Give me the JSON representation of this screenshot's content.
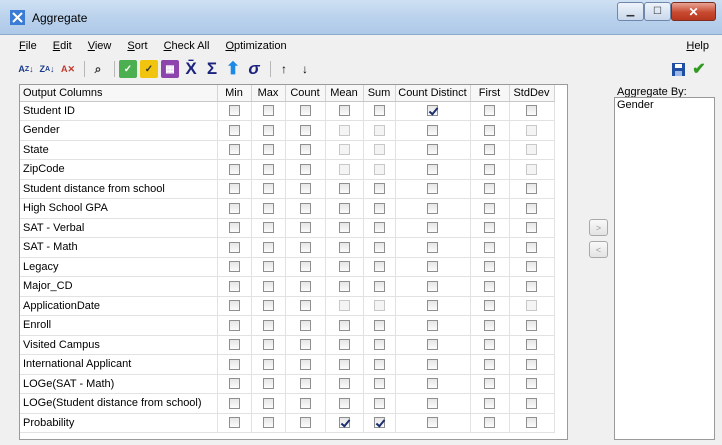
{
  "window": {
    "title": "Aggregate"
  },
  "menu": {
    "file": "File",
    "edit": "Edit",
    "view": "View",
    "sort": "Sort",
    "check_all": "Check All",
    "optimization": "Optimization",
    "help": "Help"
  },
  "columns": [
    "Output Columns",
    "Min",
    "Max",
    "Count",
    "Mean",
    "Sum",
    "Count Distinct",
    "First",
    "StdDev"
  ],
  "rows": [
    {
      "name": "Student ID",
      "states": [
        "n",
        "n",
        "n",
        "n",
        "n",
        "c",
        "n",
        "n"
      ]
    },
    {
      "name": "Gender",
      "states": [
        "n",
        "n",
        "n",
        "d",
        "d",
        "n",
        "n",
        "d"
      ]
    },
    {
      "name": "State",
      "states": [
        "n",
        "n",
        "n",
        "d",
        "d",
        "n",
        "n",
        "d"
      ]
    },
    {
      "name": "ZipCode",
      "states": [
        "n",
        "n",
        "n",
        "d",
        "d",
        "n",
        "n",
        "d"
      ]
    },
    {
      "name": "Student distance from school",
      "states": [
        "n",
        "n",
        "n",
        "n",
        "n",
        "n",
        "n",
        "n"
      ]
    },
    {
      "name": "High School GPA",
      "states": [
        "n",
        "n",
        "n",
        "n",
        "n",
        "n",
        "n",
        "n"
      ]
    },
    {
      "name": "SAT - Verbal",
      "states": [
        "n",
        "n",
        "n",
        "n",
        "n",
        "n",
        "n",
        "n"
      ]
    },
    {
      "name": "SAT - Math",
      "states": [
        "n",
        "n",
        "n",
        "n",
        "n",
        "n",
        "n",
        "n"
      ]
    },
    {
      "name": "Legacy",
      "states": [
        "n",
        "n",
        "n",
        "n",
        "n",
        "n",
        "n",
        "n"
      ]
    },
    {
      "name": "Major_CD",
      "states": [
        "n",
        "n",
        "n",
        "n",
        "n",
        "n",
        "n",
        "n"
      ]
    },
    {
      "name": "ApplicationDate",
      "states": [
        "n",
        "n",
        "n",
        "d",
        "d",
        "n",
        "n",
        "d"
      ]
    },
    {
      "name": "Enroll",
      "states": [
        "n",
        "n",
        "n",
        "n",
        "n",
        "n",
        "n",
        "n"
      ]
    },
    {
      "name": "Visited Campus",
      "states": [
        "n",
        "n",
        "n",
        "n",
        "n",
        "n",
        "n",
        "n"
      ]
    },
    {
      "name": "International Applicant",
      "states": [
        "n",
        "n",
        "n",
        "n",
        "n",
        "n",
        "n",
        "n"
      ]
    },
    {
      "name": "LOGe(SAT - Math)",
      "states": [
        "n",
        "n",
        "n",
        "n",
        "n",
        "n",
        "n",
        "n"
      ]
    },
    {
      "name": "LOGe(Student distance from school)",
      "states": [
        "n",
        "n",
        "n",
        "n",
        "n",
        "n",
        "n",
        "n"
      ]
    },
    {
      "name": "Probability",
      "states": [
        "n",
        "n",
        "n",
        "c",
        "c",
        "n",
        "n",
        "n"
      ]
    }
  ],
  "aggregate_by": {
    "label": "Aggregate By:",
    "items": [
      "Gender"
    ]
  },
  "toolbar_icons": [
    "sort-ascending-icon",
    "sort-descending-icon",
    "clear-sort-icon",
    "find-icon",
    "select-all-icon",
    "select-numeric-icon",
    "select-other-icon",
    "count-distinct-icon",
    "sum-icon",
    "max-icon",
    "stddev-icon",
    "move-up-icon",
    "move-down-icon"
  ],
  "colors": {
    "check": "#1c2f6e",
    "save": "#1e4fa3",
    "ok": "#2f9a1f"
  }
}
